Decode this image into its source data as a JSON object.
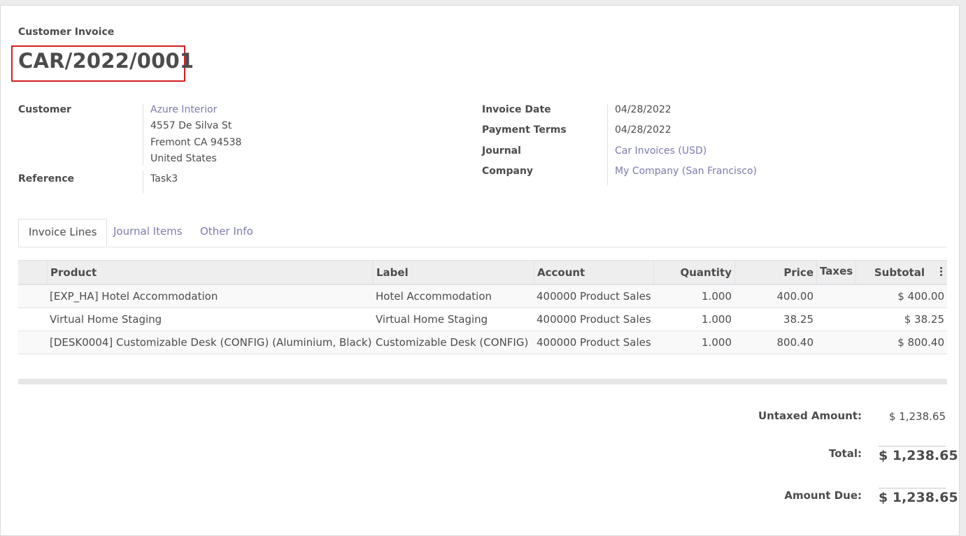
{
  "header": {
    "doc_type": "Customer Invoice",
    "doc_number": "CAR/2022/0001"
  },
  "left_fields": {
    "customer_label": "Customer",
    "customer_name": "Azure Interior",
    "address_line1": "4557 De Silva St",
    "address_line2": "Fremont CA 94538",
    "address_line3": "United States",
    "reference_label": "Reference",
    "reference_value": "Task3"
  },
  "right_fields": {
    "invoice_date_label": "Invoice Date",
    "invoice_date_value": "04/28/2022",
    "payment_terms_label": "Payment Terms",
    "payment_terms_value": "04/28/2022",
    "journal_label": "Journal",
    "journal_value": "Car Invoices (USD)",
    "company_label": "Company",
    "company_value": "My Company (San Francisco)"
  },
  "tabs": [
    {
      "label": "Invoice Lines",
      "active": true
    },
    {
      "label": "Journal Items",
      "active": false
    },
    {
      "label": "Other Info",
      "active": false
    }
  ],
  "table": {
    "headers": {
      "product": "Product",
      "label": "Label",
      "account": "Account",
      "quantity": "Quantity",
      "price": "Price",
      "taxes": "Taxes",
      "subtotal": "Subtotal"
    },
    "rows": [
      {
        "product": "[EXP_HA] Hotel Accommodation",
        "label": "Hotel Accommodation",
        "account": "400000 Product Sales",
        "quantity": "1.000",
        "price": "400.00",
        "taxes": "",
        "subtotal": "$ 400.00"
      },
      {
        "product": "Virtual Home Staging",
        "label": "Virtual Home Staging",
        "account": "400000 Product Sales",
        "quantity": "1.000",
        "price": "38.25",
        "taxes": "",
        "subtotal": "$ 38.25"
      },
      {
        "product": "[DESK0004] Customizable Desk (CONFIG) (Aluminium, Black)",
        "label": "Customizable Desk (CONFIG)",
        "account": "400000 Product Sales",
        "quantity": "1.000",
        "price": "800.40",
        "taxes": "",
        "subtotal": "$ 800.40"
      }
    ]
  },
  "totals": {
    "untaxed_label": "Untaxed Amount:",
    "untaxed_value": "$ 1,238.65",
    "total_label": "Total:",
    "total_value": "$ 1,238.65",
    "amount_due_label": "Amount Due:",
    "amount_due_value": "$ 1,238.65"
  },
  "colors": {
    "link": "#7c7bad",
    "highlight": "#d21f1f",
    "text": "#4c4c4c"
  }
}
